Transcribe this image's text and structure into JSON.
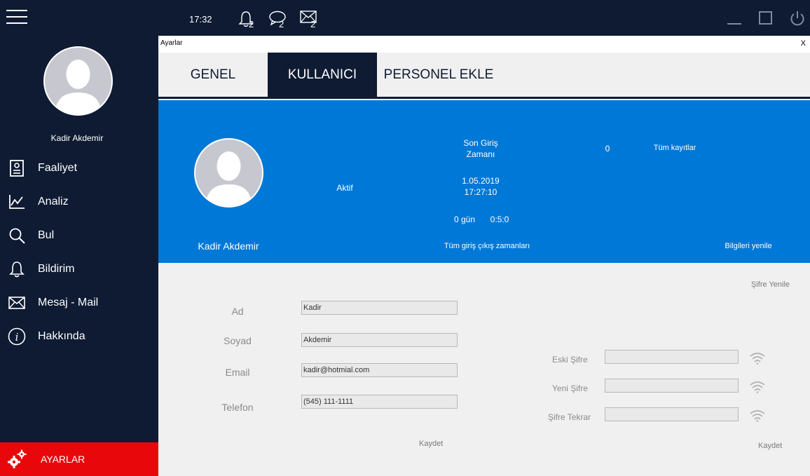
{
  "topbar": {
    "time": "17:32",
    "notifications_count": "2",
    "messages_count": "2",
    "mail_count": "2"
  },
  "sidebar": {
    "username": "Kadir  Akdemir",
    "items": [
      {
        "label": "Faaliyet"
      },
      {
        "label": "Analiz"
      },
      {
        "label": "Bul"
      },
      {
        "label": "Bildirim"
      },
      {
        "label": "Mesaj - Mail"
      },
      {
        "label": "Hakkında"
      }
    ],
    "settings_label": "AYARLAR"
  },
  "window": {
    "title": "Ayarlar",
    "close": "X"
  },
  "tabs": [
    "GENEL",
    "KULLANICI",
    "PERSONEL EKLE"
  ],
  "profile": {
    "name": "Kadir Akdemir",
    "status": "Aktif",
    "last_login_label_1": "Son Giriş",
    "last_login_label_2": "Zamanı",
    "last_login_date": "1.05.2019",
    "last_login_time": "17:27:10",
    "duration_days": "0 gün",
    "duration_time": "0:5:0",
    "count": "0",
    "all_records": "Tüm kayıtlar",
    "all_login_times": "Tüm giriş çıkış zamanları",
    "refresh_info": "Bilgileri yenile"
  },
  "form": {
    "ad_label": "Ad",
    "ad_value": "Kadir",
    "soyad_label": "Soyad",
    "soyad_value": "Akdemir",
    "email_label": "Email",
    "email_value": "kadir@hotmial.com",
    "telefon_label": "Telefon",
    "telefon_value": "(545) 111-1111",
    "save": "Kaydet"
  },
  "password": {
    "renew": "Şifre Yenile",
    "old_label": "Eski Şifre",
    "new_label": "Yeni Şifre",
    "repeat_label": "Şifre Tekrar",
    "save": "Kaydet"
  },
  "colors": {
    "navy": "#0e1b33",
    "blue": "#0078d7",
    "red": "#e8080b"
  }
}
